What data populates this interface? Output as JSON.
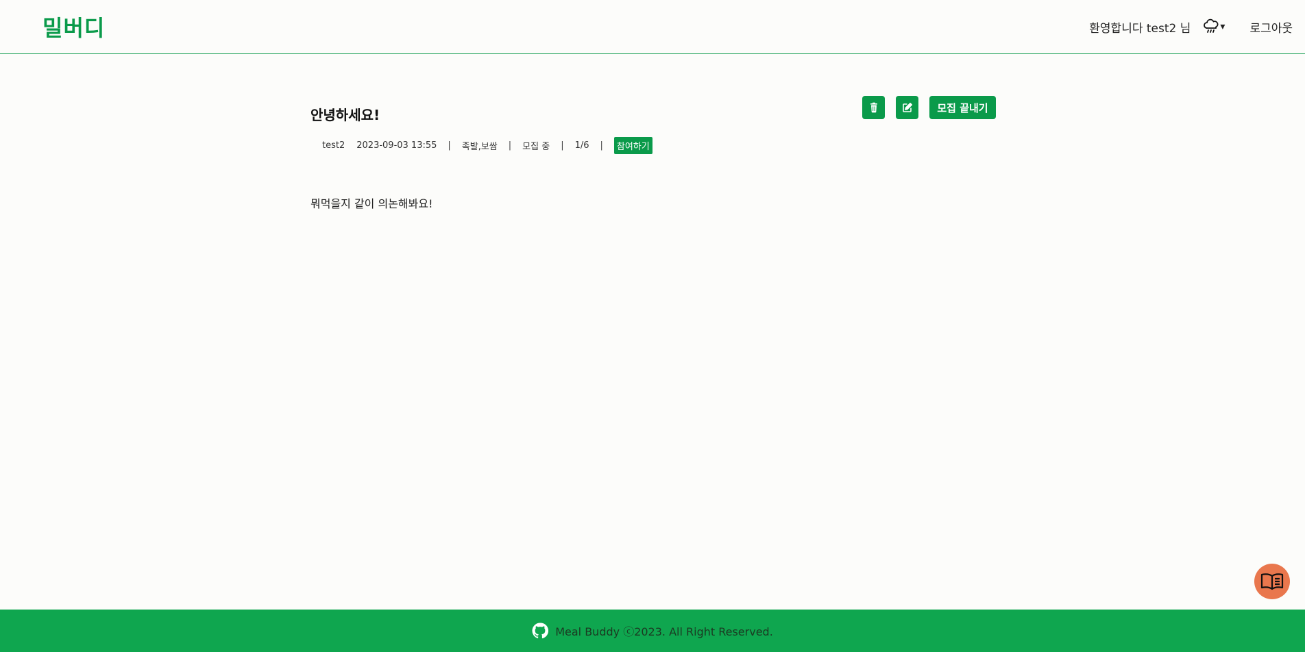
{
  "header": {
    "logo": "밀버디",
    "welcome": "환영합니다 test2 님",
    "weather_icon": "cloud-rain-icon",
    "weather_caret": "▾",
    "logout": "로그아웃"
  },
  "post": {
    "title": "안녕하세요!",
    "author": "test2",
    "datetime": "2023-09-03 13:55",
    "menu": "족발,보쌈",
    "status": "모집 중",
    "participants": "1/6",
    "join_label": "참여하기",
    "separator": "|",
    "body": "뭐먹을지 같이 의논해봐요!",
    "actions": {
      "delete_icon": "trash-icon",
      "edit_icon": "edit-icon",
      "close_label": "모집 끝내기"
    }
  },
  "floating": {
    "icon": "book-icon"
  },
  "footer": {
    "icon": "github-icon",
    "text": "Meal Buddy ⓒ2023. All Right Reserved."
  },
  "colors": {
    "accent": "#0a9a4a",
    "footer_bg": "#0fa64f",
    "float_btn": "#e9774d",
    "background": "#fcfcfa"
  }
}
